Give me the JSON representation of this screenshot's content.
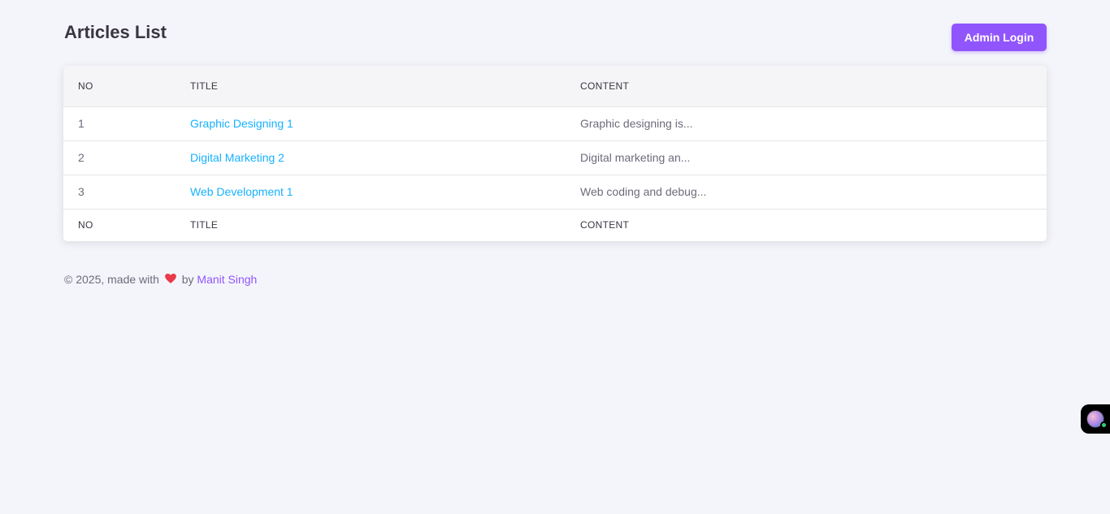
{
  "header": {
    "title": "Articles List",
    "admin_login_label": "Admin Login"
  },
  "table": {
    "columns": [
      "NO",
      "TITLE",
      "CONTENT"
    ],
    "rows": [
      {
        "no": "1",
        "title": "Graphic Designing 1",
        "content": "Graphic designing is..."
      },
      {
        "no": "2",
        "title": "Digital Marketing 2",
        "content": "Digital marketing an..."
      },
      {
        "no": "3",
        "title": "Web Development 1",
        "content": "Web coding and debug..."
      }
    ]
  },
  "footer": {
    "prefix": "© 2025, made with",
    "by": "by",
    "author": "Manit Singh"
  },
  "colors": {
    "accent": "#9155fd",
    "link": "#16b1ff",
    "heart": "#ea3a4a",
    "background": "#f4f5fa"
  },
  "icons": {
    "heart": "heart-icon",
    "widget": "avatar-icon"
  }
}
